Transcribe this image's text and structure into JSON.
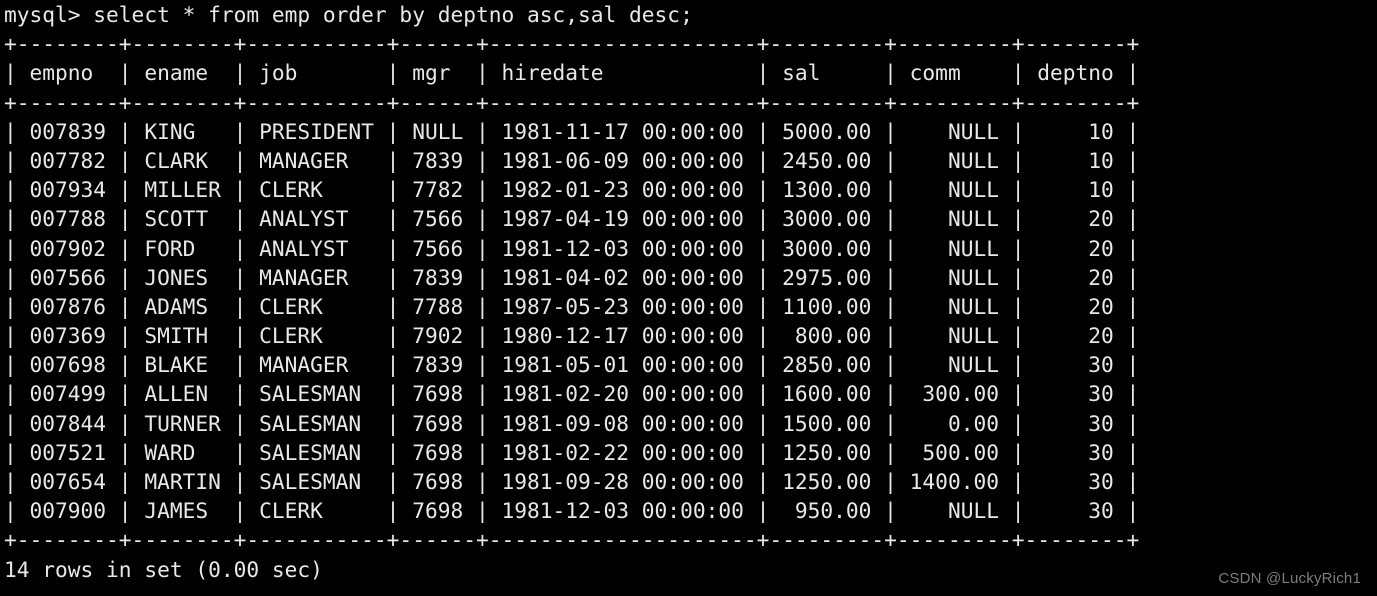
{
  "terminal": {
    "prompt": "mysql> ",
    "query": "select * from emp order by deptno asc,sal desc;",
    "prompt_line": "mysql> select * from emp order by deptno asc,sal desc;",
    "background_color": "#000000",
    "foreground_color": "#e8e8e8"
  },
  "result": {
    "columns": [
      {
        "name": "empno",
        "width": 6,
        "align": "right"
      },
      {
        "name": "ename",
        "width": 6,
        "align": "left"
      },
      {
        "name": "job",
        "width": 9,
        "align": "left"
      },
      {
        "name": "mgr",
        "width": 4,
        "align": "right"
      },
      {
        "name": "hiredate",
        "width": 19,
        "align": "left"
      },
      {
        "name": "sal",
        "width": 7,
        "align": "right"
      },
      {
        "name": "comm",
        "width": 7,
        "align": "right"
      },
      {
        "name": "deptno",
        "width": 6,
        "align": "right"
      }
    ],
    "rows": [
      {
        "empno": "007839",
        "ename": "KING",
        "job": "PRESIDENT",
        "mgr": "NULL",
        "hiredate": "1981-11-17 00:00:00",
        "sal": "5000.00",
        "comm": "NULL",
        "deptno": "10"
      },
      {
        "empno": "007782",
        "ename": "CLARK",
        "job": "MANAGER",
        "mgr": "7839",
        "hiredate": "1981-06-09 00:00:00",
        "sal": "2450.00",
        "comm": "NULL",
        "deptno": "10"
      },
      {
        "empno": "007934",
        "ename": "MILLER",
        "job": "CLERK",
        "mgr": "7782",
        "hiredate": "1982-01-23 00:00:00",
        "sal": "1300.00",
        "comm": "NULL",
        "deptno": "10"
      },
      {
        "empno": "007788",
        "ename": "SCOTT",
        "job": "ANALYST",
        "mgr": "7566",
        "hiredate": "1987-04-19 00:00:00",
        "sal": "3000.00",
        "comm": "NULL",
        "deptno": "20"
      },
      {
        "empno": "007902",
        "ename": "FORD",
        "job": "ANALYST",
        "mgr": "7566",
        "hiredate": "1981-12-03 00:00:00",
        "sal": "3000.00",
        "comm": "NULL",
        "deptno": "20"
      },
      {
        "empno": "007566",
        "ename": "JONES",
        "job": "MANAGER",
        "mgr": "7839",
        "hiredate": "1981-04-02 00:00:00",
        "sal": "2975.00",
        "comm": "NULL",
        "deptno": "20"
      },
      {
        "empno": "007876",
        "ename": "ADAMS",
        "job": "CLERK",
        "mgr": "7788",
        "hiredate": "1987-05-23 00:00:00",
        "sal": "1100.00",
        "comm": "NULL",
        "deptno": "20"
      },
      {
        "empno": "007369",
        "ename": "SMITH",
        "job": "CLERK",
        "mgr": "7902",
        "hiredate": "1980-12-17 00:00:00",
        "sal": "800.00",
        "comm": "NULL",
        "deptno": "20"
      },
      {
        "empno": "007698",
        "ename": "BLAKE",
        "job": "MANAGER",
        "mgr": "7839",
        "hiredate": "1981-05-01 00:00:00",
        "sal": "2850.00",
        "comm": "NULL",
        "deptno": "30"
      },
      {
        "empno": "007499",
        "ename": "ALLEN",
        "job": "SALESMAN",
        "mgr": "7698",
        "hiredate": "1981-02-20 00:00:00",
        "sal": "1600.00",
        "comm": "300.00",
        "deptno": "30"
      },
      {
        "empno": "007844",
        "ename": "TURNER",
        "job": "SALESMAN",
        "mgr": "7698",
        "hiredate": "1981-09-08 00:00:00",
        "sal": "1500.00",
        "comm": "0.00",
        "deptno": "30"
      },
      {
        "empno": "007521",
        "ename": "WARD",
        "job": "SALESMAN",
        "mgr": "7698",
        "hiredate": "1981-02-22 00:00:00",
        "sal": "1250.00",
        "comm": "500.00",
        "deptno": "30"
      },
      {
        "empno": "007654",
        "ename": "MARTIN",
        "job": "SALESMAN",
        "mgr": "7698",
        "hiredate": "1981-09-28 00:00:00",
        "sal": "1250.00",
        "comm": "1400.00",
        "deptno": "30"
      },
      {
        "empno": "007900",
        "ename": "JAMES",
        "job": "CLERK",
        "mgr": "7698",
        "hiredate": "1981-12-03 00:00:00",
        "sal": "950.00",
        "comm": "NULL",
        "deptno": "30"
      }
    ],
    "status": "14 rows in set (0.00 sec)",
    "row_count": 14,
    "elapsed": "0.00 sec"
  },
  "watermark": {
    "text": "CSDN @LuckyRich1"
  }
}
